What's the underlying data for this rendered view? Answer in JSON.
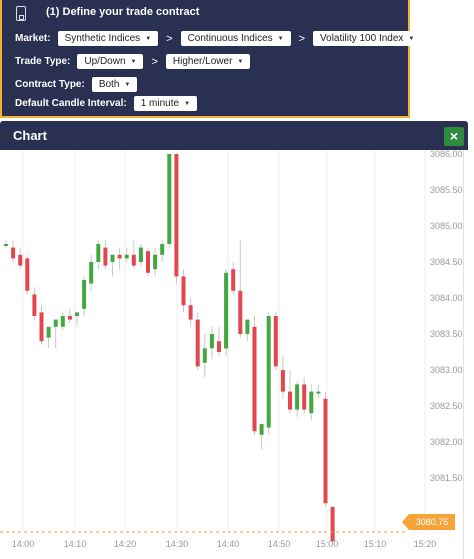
{
  "contract": {
    "title": "(1) Define your trade contract",
    "market_label": "Market:",
    "market_values": [
      "Synthetic Indices",
      "Continuous Indices",
      "Volatility 100 Index"
    ],
    "trade_type_label": "Trade Type:",
    "trade_type_values": [
      "Up/Down",
      "Higher/Lower"
    ],
    "contract_type_label": "Contract Type:",
    "contract_type_value": "Both",
    "candle_label": "Default Candle Interval:",
    "candle_value": "1 minute",
    "arrow": ">"
  },
  "chart_panel": {
    "title": "Chart",
    "close_label": "×"
  },
  "colors": {
    "panel_bg": "#2a3052",
    "panel_border": "#f2b233",
    "up": "#43a840",
    "down": "#e2474e",
    "current_price": "#f6a33a"
  },
  "chart_data": {
    "type": "candlestick",
    "y_ticks": [
      "3086.00",
      "3085.50",
      "3085.00",
      "3084.50",
      "3084.00",
      "3083.50",
      "3083.00",
      "3082.50",
      "3082.00",
      "3081.50"
    ],
    "x_ticks": [
      "14:00",
      "14:10",
      "14:20",
      "14:30",
      "14:40",
      "14:50",
      "15:00",
      "15:10",
      "15:20"
    ],
    "current_price": "3080.75",
    "candles": [
      [
        3084.75,
        3084.8,
        3084.7,
        3084.75
      ],
      [
        3084.7,
        3084.8,
        3084.5,
        3084.55
      ],
      [
        3084.6,
        3084.7,
        3084.4,
        3084.45
      ],
      [
        3084.55,
        3084.6,
        3084.05,
        3084.1
      ],
      [
        3084.05,
        3084.15,
        3083.7,
        3083.75
      ],
      [
        3083.8,
        3083.9,
        3083.35,
        3083.4
      ],
      [
        3083.45,
        3083.6,
        3083.3,
        3083.6
      ],
      [
        3083.6,
        3083.7,
        3083.3,
        3083.7
      ],
      [
        3083.6,
        3083.8,
        3083.55,
        3083.75
      ],
      [
        3083.75,
        3083.85,
        3083.65,
        3083.7
      ],
      [
        3083.75,
        3083.8,
        3083.6,
        3083.8
      ],
      [
        3083.85,
        3084.3,
        3083.75,
        3084.25
      ],
      [
        3084.2,
        3084.6,
        3084.1,
        3084.5
      ],
      [
        3084.5,
        3084.8,
        3084.4,
        3084.75
      ],
      [
        3084.7,
        3084.8,
        3084.4,
        3084.45
      ],
      [
        3084.5,
        3084.6,
        3084.3,
        3084.6
      ],
      [
        3084.6,
        3084.7,
        3084.4,
        3084.55
      ],
      [
        3084.55,
        3084.7,
        3084.5,
        3084.6
      ],
      [
        3084.6,
        3084.8,
        3084.4,
        3084.45
      ],
      [
        3084.5,
        3084.75,
        3084.45,
        3084.7
      ],
      [
        3084.65,
        3084.7,
        3084.3,
        3084.35
      ],
      [
        3084.4,
        3084.7,
        3084.3,
        3084.6
      ],
      [
        3084.6,
        3084.8,
        3084.5,
        3084.75
      ],
      [
        3084.75,
        3086.0,
        3084.7,
        3086.0
      ],
      [
        3086.0,
        3086.0,
        3084.2,
        3084.3
      ],
      [
        3084.3,
        3084.4,
        3083.8,
        3083.9
      ],
      [
        3083.9,
        3084.0,
        3083.6,
        3083.7
      ],
      [
        3083.7,
        3083.8,
        3083.0,
        3083.05
      ],
      [
        3083.1,
        3083.5,
        3082.9,
        3083.3
      ],
      [
        3083.3,
        3083.6,
        3083.15,
        3083.5
      ],
      [
        3083.4,
        3083.6,
        3083.2,
        3083.25
      ],
      [
        3083.3,
        3084.4,
        3083.2,
        3084.35
      ],
      [
        3084.4,
        3084.5,
        3084.05,
        3084.1
      ],
      [
        3084.1,
        3084.8,
        3083.45,
        3083.5
      ],
      [
        3083.5,
        3083.7,
        3083.4,
        3083.7
      ],
      [
        3083.6,
        3083.75,
        3082.1,
        3082.15
      ],
      [
        3082.1,
        3082.25,
        3081.9,
        3082.25
      ],
      [
        3082.2,
        3083.8,
        3082.1,
        3083.75
      ],
      [
        3083.75,
        3083.8,
        3083.0,
        3083.05
      ],
      [
        3083.0,
        3083.2,
        3082.6,
        3082.7
      ],
      [
        3082.7,
        3083.0,
        3082.4,
        3082.45
      ],
      [
        3082.45,
        3082.85,
        3082.35,
        3082.8
      ],
      [
        3082.8,
        3082.9,
        3082.4,
        3082.45
      ],
      [
        3082.4,
        3082.8,
        3082.3,
        3082.7
      ],
      [
        3082.7,
        3082.8,
        3082.6,
        3082.7
      ],
      [
        3082.6,
        3082.7,
        3081.1,
        3081.15
      ],
      [
        3081.1,
        3081.1,
        3080.6,
        3080.62
      ]
    ]
  }
}
